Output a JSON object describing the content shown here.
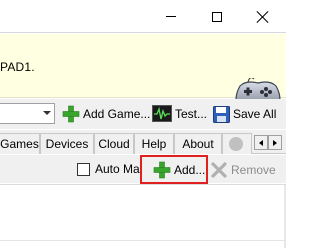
{
  "window": {
    "minimize_icon": "minimize-icon",
    "maximize_icon": "maximize-icon",
    "close_icon": "close-icon"
  },
  "banner": {
    "text": "PAD1.",
    "icon": "gamepad-icon",
    "background": "#ffffe1"
  },
  "toolbar": {
    "combo_value": "",
    "add_game_label": "Add Game...",
    "test_label": "Test...",
    "save_all_label": "Save All"
  },
  "tabs": {
    "items": [
      {
        "label": "Games"
      },
      {
        "label": "Devices"
      },
      {
        "label": "Cloud"
      },
      {
        "label": "Help"
      },
      {
        "label": "About"
      }
    ]
  },
  "subtoolbar": {
    "auto_map_label": "Auto Map",
    "auto_map_checked": false,
    "add_label": "Add...",
    "remove_label": "Remove",
    "highlight_color": "#e02020"
  }
}
